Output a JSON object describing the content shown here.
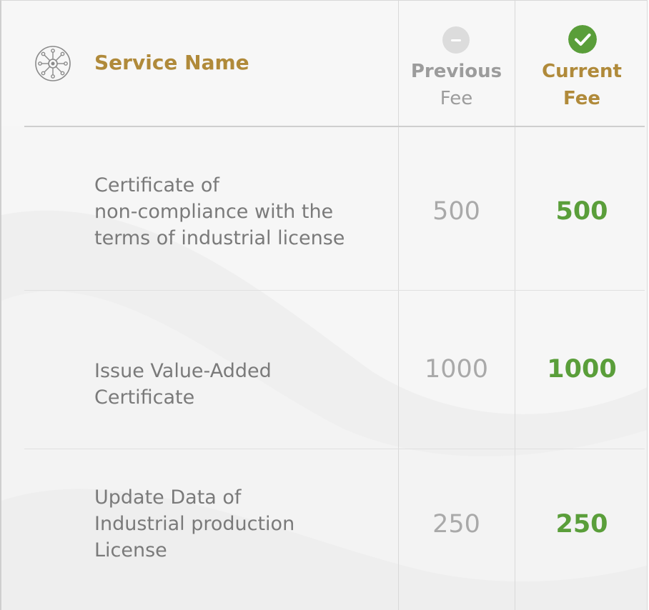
{
  "header": {
    "service_name": "Service Name",
    "previous_fee_line1": "Previous",
    "previous_fee_line2": "Fee",
    "current_fee_line1": "Current",
    "current_fee_line2": "Fee"
  },
  "rows": [
    {
      "service_lines": [
        "Certificate of",
        "non-compliance with the",
        "terms of industrial license"
      ],
      "previous_fee": "500",
      "current_fee": "500"
    },
    {
      "service_lines": [
        "Issue Value-Added",
        "Certificate"
      ],
      "previous_fee": "1000",
      "current_fee": "1000"
    },
    {
      "service_lines": [
        "Update Data of",
        "Industrial production",
        "License"
      ],
      "previous_fee": "250",
      "current_fee": "250"
    }
  ],
  "colors": {
    "gold": "#b08a3a",
    "green": "#5a9e3a",
    "grey_text": "#7a7a7a",
    "grey_value": "#a9a9a9"
  },
  "icons": {
    "service": "network-node-icon",
    "previous": "minus-circle-icon",
    "current": "check-circle-icon"
  }
}
